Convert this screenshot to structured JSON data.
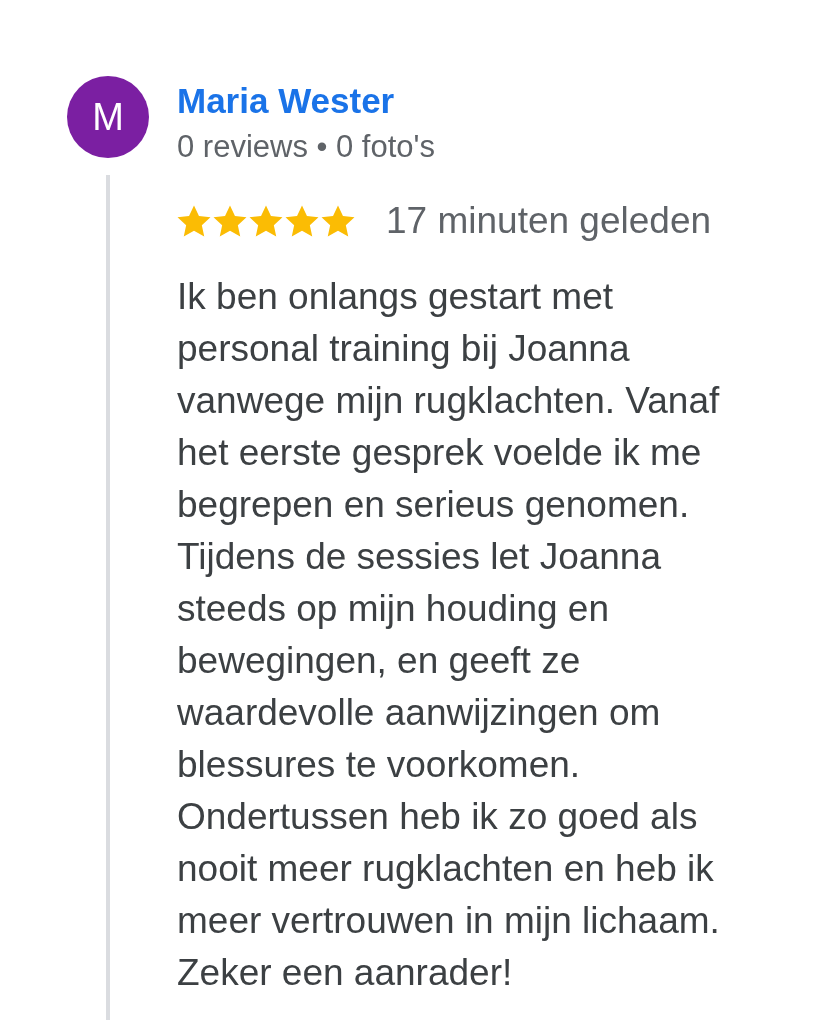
{
  "review": {
    "avatar_initial": "M",
    "author": "Maria Wester",
    "meta": "0 reviews • 0 foto's",
    "stars": 5,
    "time": "17 minuten geleden",
    "text": "Ik ben onlangs gestart met personal training bij Joanna vanwege mijn rugklachten. Vanaf het eerste gesprek voelde ik me begrepen en serieus genomen. Tijdens de sessies let Joanna steeds op mijn houding en bewegingen, en geeft ze waardevolle aanwijzingen om blessures te voorkomen. Ondertussen heb ik zo goed als nooit meer rugklachten en heb ik meer vertrouwen in mijn lichaam. Zeker een aanrader!"
  }
}
